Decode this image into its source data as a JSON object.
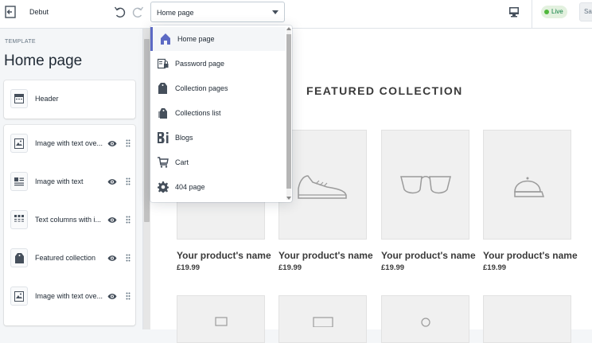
{
  "topbar": {
    "theme_name": "Debut",
    "page_select_value": "Home page",
    "live_label": "Live",
    "save_label": "Save"
  },
  "sidebar": {
    "template_label": "TEMPLATE",
    "template_title": "Home page",
    "header_label": "Header",
    "sections": [
      {
        "label": "Image with text ove...",
        "icon": "image-text-overlay-icon"
      },
      {
        "label": "Image with text",
        "icon": "image-text-icon"
      },
      {
        "label": "Text columns with i...",
        "icon": "text-columns-icon"
      },
      {
        "label": "Featured collection",
        "icon": "collection-tag-icon"
      },
      {
        "label": "Image with text ove...",
        "icon": "image-text-overlay-icon"
      }
    ]
  },
  "dropdown": {
    "items": [
      {
        "label": "Home page",
        "icon": "home-icon",
        "active": true
      },
      {
        "label": "Password page",
        "icon": "password-icon",
        "active": false
      },
      {
        "label": "Collection pages",
        "icon": "collection-icon",
        "active": false
      },
      {
        "label": "Collections list",
        "icon": "collections-list-icon",
        "active": false
      },
      {
        "label": "Blogs",
        "icon": "blogs-icon",
        "active": false
      },
      {
        "label": "Cart",
        "icon": "cart-icon",
        "active": false
      },
      {
        "label": "404 page",
        "icon": "gear-icon",
        "active": false
      }
    ]
  },
  "preview": {
    "featured_title": "FEATURED COLLECTION",
    "products": [
      {
        "name": "Your product's name",
        "price": "£19.99",
        "icon": "phone-icon"
      },
      {
        "name": "Your product's name",
        "price": "£19.99",
        "icon": "shoe-icon"
      },
      {
        "name": "Your product's name",
        "price": "£19.99",
        "icon": "sunglasses-icon"
      },
      {
        "name": "Your product's name",
        "price": "£19.99",
        "icon": "cap-icon"
      }
    ]
  },
  "colors": {
    "accent": "#5c6ac4",
    "live_bg": "#e3f1df",
    "live_dot": "#50b83c"
  }
}
